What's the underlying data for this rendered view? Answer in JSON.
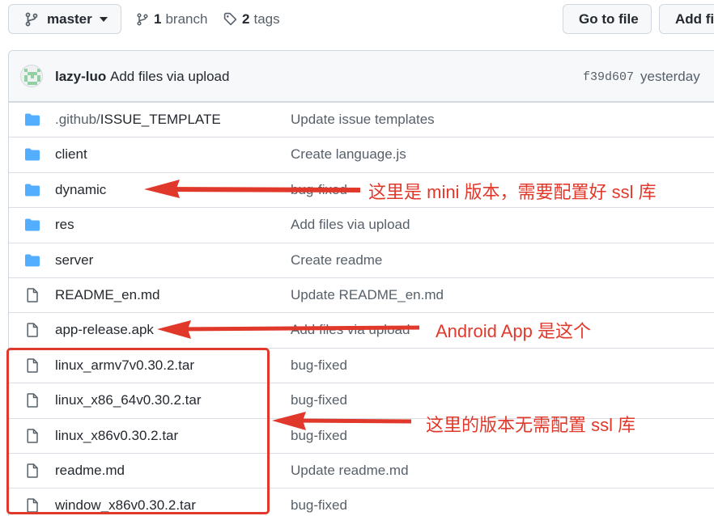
{
  "toolbar": {
    "branch_name": "master",
    "branch_count": "1",
    "branch_label": "branch",
    "tag_count": "2",
    "tag_label": "tags",
    "go_to_file": "Go to file",
    "add_file": "Add fi"
  },
  "commit": {
    "author": "lazy-luo",
    "message": "Add files via upload",
    "sha": "f39d607",
    "time": "yesterday"
  },
  "files": [
    {
      "type": "folder",
      "name_prefix": ".github/",
      "name": "ISSUE_TEMPLATE",
      "message": "Update issue templates"
    },
    {
      "type": "folder",
      "name_prefix": "",
      "name": "client",
      "message": "Create language.js"
    },
    {
      "type": "folder",
      "name_prefix": "",
      "name": "dynamic",
      "message": "bug-fixed"
    },
    {
      "type": "folder",
      "name_prefix": "",
      "name": "res",
      "message": "Add files via upload"
    },
    {
      "type": "folder",
      "name_prefix": "",
      "name": "server",
      "message": "Create readme"
    },
    {
      "type": "file",
      "name_prefix": "",
      "name": "README_en.md",
      "message": "Update README_en.md"
    },
    {
      "type": "file",
      "name_prefix": "",
      "name": "app-release.apk",
      "message": "Add files via upload"
    },
    {
      "type": "file",
      "name_prefix": "",
      "name": "linux_armv7v0.30.2.tar",
      "message": "bug-fixed"
    },
    {
      "type": "file",
      "name_prefix": "",
      "name": "linux_x86_64v0.30.2.tar",
      "message": "bug-fixed"
    },
    {
      "type": "file",
      "name_prefix": "",
      "name": "linux_x86v0.30.2.tar",
      "message": "bug-fixed"
    },
    {
      "type": "file",
      "name_prefix": "",
      "name": "readme.md",
      "message": "Update readme.md"
    },
    {
      "type": "file",
      "name_prefix": "",
      "name": "window_x86v0.30.2.tar",
      "message": "bug-fixed"
    }
  ],
  "annotations": {
    "mini_note": "这里是 mini 版本，需要配置好 ssl 库",
    "android_note": "Android App 是这个",
    "nossl_note": "这里的版本无需配置 ssl 库",
    "color": "#e0392b"
  },
  "colors": {
    "folder_icon": "#54aeff",
    "file_icon": "#57606a",
    "border": "#d0d7de"
  }
}
